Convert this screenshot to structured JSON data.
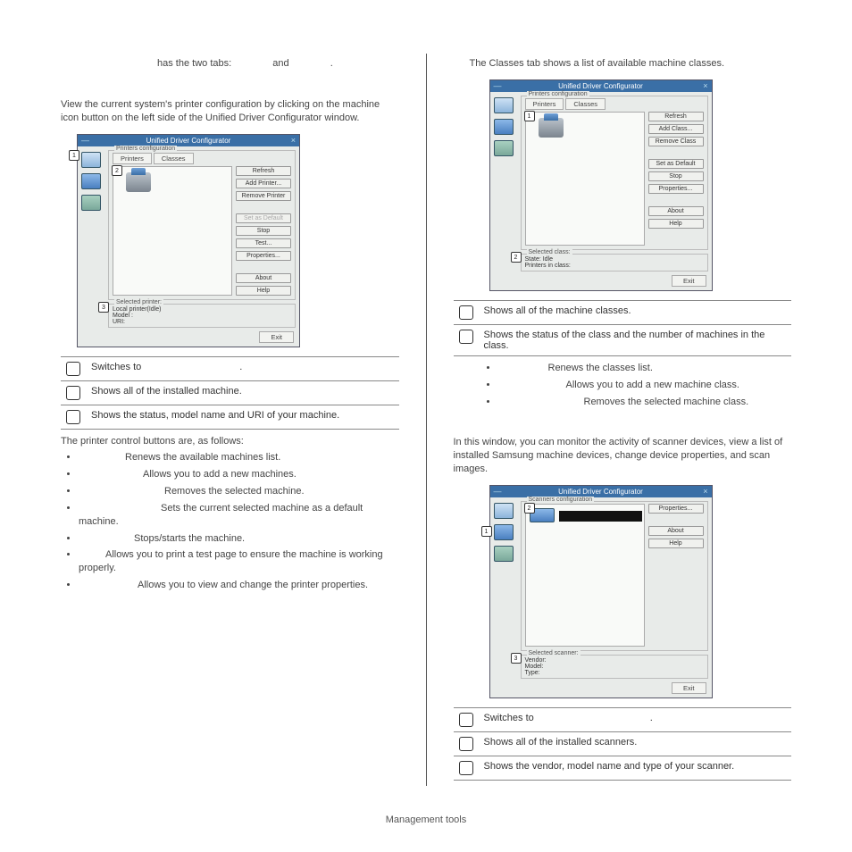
{
  "footer": {
    "text": "Management tools"
  },
  "left": {
    "intro": {
      "l1": "has the two tabs:",
      "and": "and",
      "dot": ".",
      "para": "View the current system's printer configuration by clicking on the machine icon button on the left side of the Unified Driver Configurator window."
    },
    "dialog": {
      "title": "Unified Driver Configurator",
      "group": "Printers configuration",
      "tabs": {
        "printers": "Printers",
        "classes": "Classes"
      },
      "buttons": {
        "refresh": "Refresh",
        "add": "Add Printer...",
        "remove": "Remove Printer",
        "setdefault": "Set as Default",
        "stop": "Stop",
        "test": "Test...",
        "properties": "Properties...",
        "about": "About",
        "help": "Help"
      },
      "selected": {
        "title": "Selected printer:",
        "l1": "Local printer(Idle)",
        "l2": "Model :",
        "l3": "URI:"
      },
      "exit": "Exit",
      "callouts": {
        "c1": "1",
        "c2": "2",
        "c3": "3"
      }
    },
    "table": {
      "r1": "Switches to",
      "r2": "Shows all of the installed machine.",
      "r3": "Shows the status, model name and URI of your machine."
    },
    "after_table": "The printer control buttons are, as follows:",
    "bullets": {
      "b1": "Renews the available machines list.",
      "b2": "Allows you to add a new machines.",
      "b3": "Removes the selected machine.",
      "b4": "Sets the current selected machine as a default machine.",
      "b5": "Stops/starts the machine.",
      "b6": "Allows you to print a test page to ensure the machine is working properly.",
      "b7": "Allows you to view and change the printer properties."
    }
  },
  "right": {
    "classes_intro": "The Classes tab shows a list of available machine classes.",
    "dialog_classes": {
      "title": "Unified Driver Configurator",
      "group": "Printers configuration",
      "tabs": {
        "printers": "Printers",
        "classes": "Classes"
      },
      "buttons": {
        "refresh": "Refresh",
        "add": "Add Class...",
        "remove": "Remove Class",
        "setdefault": "Set as Default",
        "stop": "Stop",
        "properties": "Properties...",
        "about": "About",
        "help": "Help"
      },
      "selected": {
        "title": "Selected class:",
        "l1": "State: Idle",
        "l2": "Printers in class:"
      },
      "exit": "Exit",
      "callouts": {
        "c1": "1",
        "c2": "2"
      }
    },
    "table_classes": {
      "r1": "Shows all of the machine classes.",
      "r2": "Shows the status of the class and the number of machines in the class."
    },
    "bullets_classes": {
      "b1": "Renews the classes list.",
      "b2": "Allows you to add a new machine class.",
      "b3": "Removes the selected machine class."
    },
    "scanners_heading": "",
    "scanners_intro": "In this window, you can monitor the activity of scanner devices, view a list of installed Samsung machine devices, change device properties, and scan images.",
    "dialog_scanners": {
      "title": "Unified Driver Configurator",
      "group": "Scanners configuration",
      "buttons": {
        "properties": "Properties...",
        "about": "About",
        "help": "Help"
      },
      "selected": {
        "title": "Selected scanner:",
        "l1": "Vendor:",
        "l2": "Model:",
        "l3": "Type:"
      },
      "exit": "Exit",
      "callouts": {
        "c1": "1",
        "c2": "2",
        "c3": "3"
      }
    },
    "table_scanners": {
      "r1": "Switches to",
      "r2": "Shows all of the installed scanners.",
      "r3": "Shows the vendor, model name and type of your scanner."
    }
  }
}
